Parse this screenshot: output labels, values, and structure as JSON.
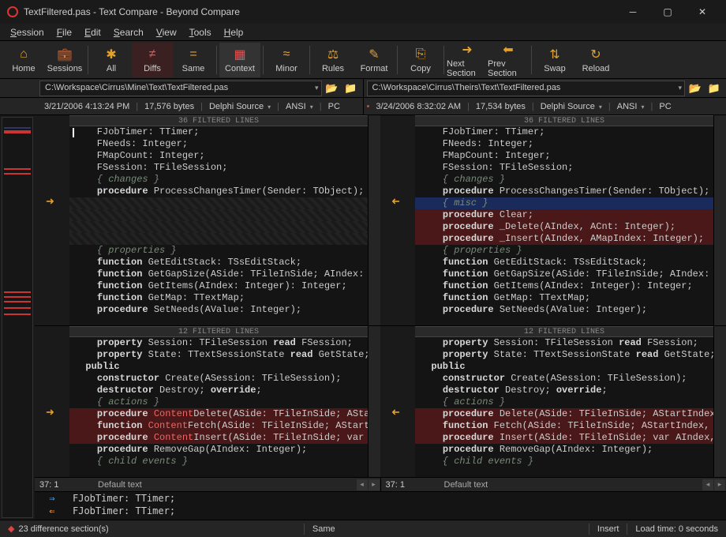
{
  "titlebar": {
    "title": "TextFiltered.pas - Text Compare - Beyond Compare"
  },
  "menubar": [
    "Session",
    "File",
    "Edit",
    "Search",
    "View",
    "Tools",
    "Help"
  ],
  "toolbar": [
    {
      "label": "Home",
      "icon": "⌂"
    },
    {
      "label": "Sessions",
      "icon": "💼"
    },
    {
      "sep": true
    },
    {
      "label": "All",
      "icon": "✱"
    },
    {
      "label": "Diffs",
      "icon": "≠",
      "active": true,
      "red": true
    },
    {
      "label": "Same",
      "icon": "="
    },
    {
      "sep": true
    },
    {
      "label": "Context",
      "icon": "▦",
      "active2": true,
      "red": true
    },
    {
      "sep": true
    },
    {
      "label": "Minor",
      "icon": "≈"
    },
    {
      "sep": true
    },
    {
      "label": "Rules",
      "icon": "⚖"
    },
    {
      "label": "Format",
      "icon": "✎"
    },
    {
      "sep": true
    },
    {
      "label": "Copy",
      "icon": "⎘"
    },
    {
      "sep": true
    },
    {
      "label": "Next Section",
      "icon": "➜"
    },
    {
      "label": "Prev Section",
      "icon": "⬅"
    },
    {
      "sep": true
    },
    {
      "label": "Swap",
      "icon": "⇅"
    },
    {
      "label": "Reload",
      "icon": "↻"
    }
  ],
  "paths": {
    "left": "C:\\Workspace\\Cirrus\\Mine\\Text\\TextFiltered.pas",
    "right": "C:\\Workspace\\Cirrus\\Theirs\\Text\\TextFiltered.pas"
  },
  "meta": {
    "left": {
      "date": "3/21/2006 4:13:24 PM",
      "size": "17,576 bytes",
      "lang": "Delphi Source",
      "enc": "ANSI",
      "os": "PC"
    },
    "right": {
      "date": "3/24/2006 8:32:02 AM",
      "size": "17,534 bytes",
      "lang": "Delphi Source",
      "enc": "ANSI",
      "os": "PC"
    }
  },
  "fold1": "36 FILTERED LINES",
  "fold2": "12 FILTERED LINES",
  "left_code1": [
    {
      "t": "    FJobTimer: TTimer;"
    },
    {
      "t": "    FNeeds: Integer;"
    },
    {
      "t": "    FMapCount: Integer;"
    },
    {
      "t": "    FSession: TFileSession;"
    },
    {
      "t": "    { changes }",
      "c": true
    },
    {
      "t": "    procedure ProcessChangesTimer(Sender: TObject);",
      "kw": "procedure"
    },
    {
      "t": "",
      "miss": true
    },
    {
      "t": "",
      "miss": true
    },
    {
      "t": "",
      "miss": true
    },
    {
      "t": "",
      "miss": true
    },
    {
      "t": "    { properties }",
      "c": true
    },
    {
      "t": "    function GetEditStack: TSsEditStack;",
      "kw": "function"
    },
    {
      "t": "    function GetGapSize(ASide: TFileInSide; AIndex: In",
      "kw": "function"
    },
    {
      "t": "    function GetItems(AIndex: Integer): Integer;",
      "kw": "function"
    },
    {
      "t": "    function GetMap: TTextMap;",
      "kw": "function"
    },
    {
      "t": "    procedure SetNeeds(AValue: Integer);",
      "kw": "procedure"
    }
  ],
  "right_code1": [
    {
      "t": "    FJobTimer: TTimer;"
    },
    {
      "t": "    FNeeds: Integer;"
    },
    {
      "t": "    FMapCount: Integer;"
    },
    {
      "t": "    FSession: TFileSession;"
    },
    {
      "t": "    { changes }",
      "c": true
    },
    {
      "t": "    procedure ProcessChangesTimer(Sender: TObject);",
      "kw": "procedure"
    },
    {
      "t": "    { misc }",
      "c": true,
      "diffblue": true
    },
    {
      "t": "    procedure Clear;",
      "kw": "procedure",
      "diffred": true
    },
    {
      "t": "    procedure _Delete(AIndex, ACnt: Integer);",
      "kw": "procedure",
      "diffred": true
    },
    {
      "t": "    procedure _Insert(AIndex, AMapIndex: Integer);",
      "kw": "procedure",
      "diffred": true
    },
    {
      "t": "    { properties }",
      "c": true
    },
    {
      "t": "    function GetEditStack: TSsEditStack;",
      "kw": "function"
    },
    {
      "t": "    function GetGapSize(ASide: TFileInSide; AIndex: In",
      "kw": "function"
    },
    {
      "t": "    function GetItems(AIndex: Integer): Integer;",
      "kw": "function"
    },
    {
      "t": "    function GetMap: TTextMap;",
      "kw": "function"
    },
    {
      "t": "    procedure SetNeeds(AValue: Integer);",
      "kw": "procedure"
    }
  ],
  "left_code2": [
    {
      "t": "    property Session: TFileSession read FSession;",
      "kw": "property",
      "kw2": "read"
    },
    {
      "t": "    property State: TTextSessionState read GetState;",
      "kw": "property",
      "kw2": "read"
    },
    {
      "t": "  public",
      "kw": "public"
    },
    {
      "t": "    constructor Create(ASession: TFileSession);",
      "kw": "constructor"
    },
    {
      "t": "    destructor Destroy; override;",
      "kw": "destructor",
      "kw2": "override"
    },
    {
      "t": "    { actions }",
      "c": true
    },
    {
      "t": "    procedure ContentDelete(ASide: TFileInSide; AStartIn",
      "kw": "procedure",
      "diffred": true,
      "redword": "Content"
    },
    {
      "t": "    function ContentFetch(ASide: TFileInSide; AStartIn",
      "kw": "function",
      "diffred": true,
      "redword": "Content"
    },
    {
      "t": "    procedure ContentInsert(ASide: TFileInSide; var AI",
      "kw": "procedure",
      "diffred": true,
      "redword": "Content"
    },
    {
      "t": "    procedure RemoveGap(AIndex: Integer);",
      "kw": "procedure"
    },
    {
      "t": "    { child events }",
      "c": true
    }
  ],
  "right_code2": [
    {
      "t": "    property Session: TFileSession read FSession;",
      "kw": "property",
      "kw2": "read"
    },
    {
      "t": "    property State: TTextSessionState read GetState;",
      "kw": "property",
      "kw2": "read"
    },
    {
      "t": "  public",
      "kw": "public"
    },
    {
      "t": "    constructor Create(ASession: TFileSession);",
      "kw": "constructor"
    },
    {
      "t": "    destructor Destroy; override;",
      "kw": "destructor",
      "kw2": "override"
    },
    {
      "t": "    { actions }",
      "c": true
    },
    {
      "t": "    procedure Delete(ASide: TFileInSide; AStartIndex, ",
      "kw": "procedure",
      "diffred": true
    },
    {
      "t": "    function Fetch(ASide: TFileInSide; AStartIndex, AS",
      "kw": "function",
      "diffred": true
    },
    {
      "t": "    procedure Insert(ASide: TFileInSide; var AIndex, A",
      "kw": "procedure",
      "diffred": true
    },
    {
      "t": "    procedure RemoveGap(AIndex: Integer);",
      "kw": "procedure"
    },
    {
      "t": "    { child events }",
      "c": true
    }
  ],
  "merge": [
    {
      "dir": "right",
      "text": "FJobTimer: TTimer;"
    },
    {
      "dir": "left",
      "text": "FJobTimer: TTimer;"
    }
  ],
  "hscroll": {
    "pos_left": "37: 1",
    "pos_right": "37: 1",
    "textstyle": "Default text"
  },
  "status": {
    "diff": "23 difference section(s)",
    "same": "Same",
    "insert": "Insert",
    "load": "Load time: 0 seconds"
  }
}
